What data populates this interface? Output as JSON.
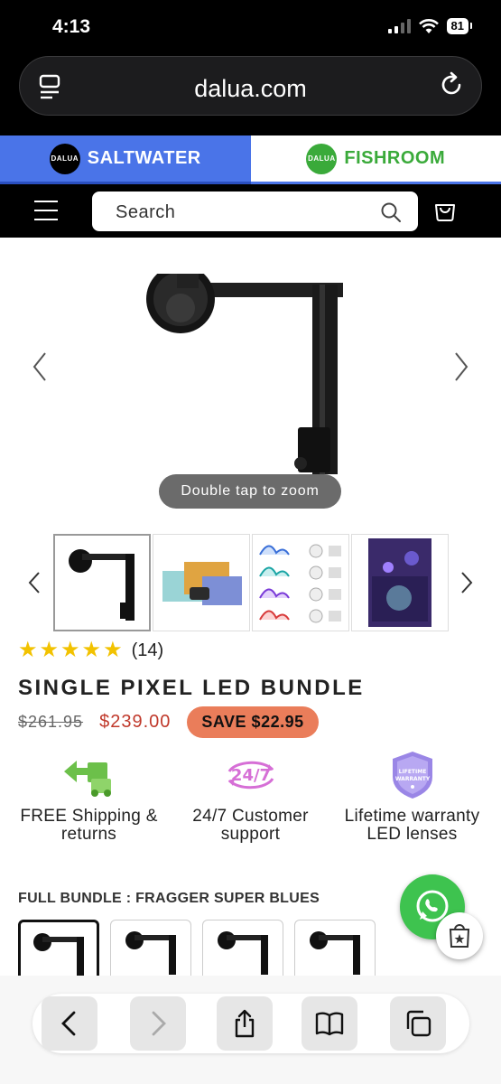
{
  "status": {
    "time": "4:13",
    "battery": "81"
  },
  "browser": {
    "url": "dalua.com"
  },
  "store_tabs": [
    {
      "logo": "DALUA",
      "label": "SALTWATER"
    },
    {
      "logo": "DALUA",
      "label": "FISHROOM"
    }
  ],
  "header": {
    "search_placeholder": "Search"
  },
  "gallery": {
    "zoom_hint": "Double tap to zoom"
  },
  "product": {
    "rating_count": "(14)",
    "rating_stars": 5,
    "title": "SINGLE PIXEL LED BUNDLE",
    "old_price": "$261.95",
    "price": "$239.00",
    "save": "SAVE $22.95"
  },
  "features": [
    {
      "icon": "truck-icon",
      "label": "FREE Shipping & returns"
    },
    {
      "icon": "24-7-icon",
      "label": "24/7 Customer support"
    },
    {
      "icon": "warranty-shield-icon",
      "label": "Lifetime warranty LED lenses",
      "badge_text": "LIFETIME WARRANTY"
    }
  ],
  "bundle": {
    "label": "FULL BUNDLE : FRAGGER SUPER BLUES"
  },
  "colors": {
    "salt_blue": "#4a74e8",
    "fish_green": "#3aaa3a",
    "sale_red": "#c0392b",
    "save_orange": "#ea7d5a",
    "whatsapp_green": "#3ec34f"
  }
}
